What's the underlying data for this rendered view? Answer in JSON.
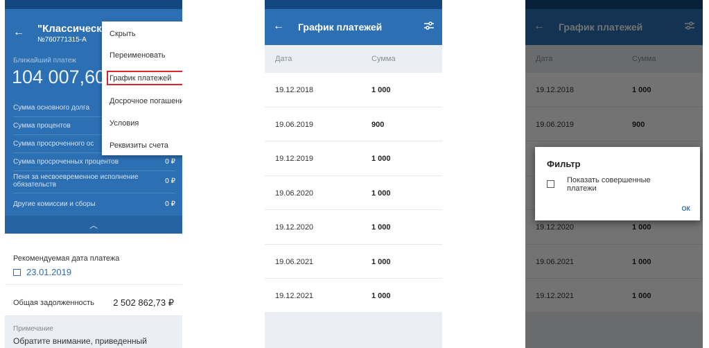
{
  "screen1": {
    "title": "\"Классически",
    "subtitle": "№760771315-А",
    "nearest_label": "Ближайший платеж",
    "nearest_amount": "104 007,60",
    "rows": [
      {
        "label": "Сумма основного долга",
        "value": ""
      },
      {
        "label": "Сумма процентов",
        "value": ""
      },
      {
        "label": "Сумма просроченного ос",
        "value": ""
      },
      {
        "label": "Сумма просроченных процентов",
        "value": "0 ₽"
      },
      {
        "label": "Пеня за несвоевременное исполнение обязательств",
        "value": "0 ₽"
      },
      {
        "label": "Другие комиссии и сборы",
        "value": "0 ₽"
      }
    ],
    "rec_date_label": "Рекомендуемая дата платежа",
    "rec_date_value": "23.01.2019",
    "total_label": "Общая задолженность",
    "total_value": "2 502 862,73 ₽",
    "note_label": "Примечание",
    "note_value": "Обратите внимание, приведенный",
    "menu": [
      "Скрыть",
      "Переименовать",
      "График платежей",
      "Досрочное погашение",
      "Условия",
      "Реквизиты счета"
    ]
  },
  "schedule": {
    "title": "График платежей",
    "col_date": "Дата",
    "col_sum": "Сумма",
    "rows": [
      {
        "date": "19.12.2018",
        "sum": "1 000"
      },
      {
        "date": "19.06.2019",
        "sum": "900"
      },
      {
        "date": "19.12.2019",
        "sum": "1 000"
      },
      {
        "date": "19.06.2020",
        "sum": "1 000"
      },
      {
        "date": "19.12.2020",
        "sum": "1 000"
      },
      {
        "date": "19.06.2021",
        "sum": "1 000"
      },
      {
        "date": "19.12.2021",
        "sum": "1 000"
      }
    ]
  },
  "filter_dialog": {
    "title": "Фильтр",
    "checkbox_label": "Показать совершенные платежи",
    "ok": "ОК"
  },
  "colors": {
    "primary": "#2d6fb3",
    "status": "#12487f",
    "highlight": "#d9262c",
    "bg": "#ebeef2"
  },
  "icons": [
    "back-arrow-icon",
    "filter-icon",
    "chevron-up-icon",
    "calendar-icon",
    "checkbox-icon"
  ]
}
